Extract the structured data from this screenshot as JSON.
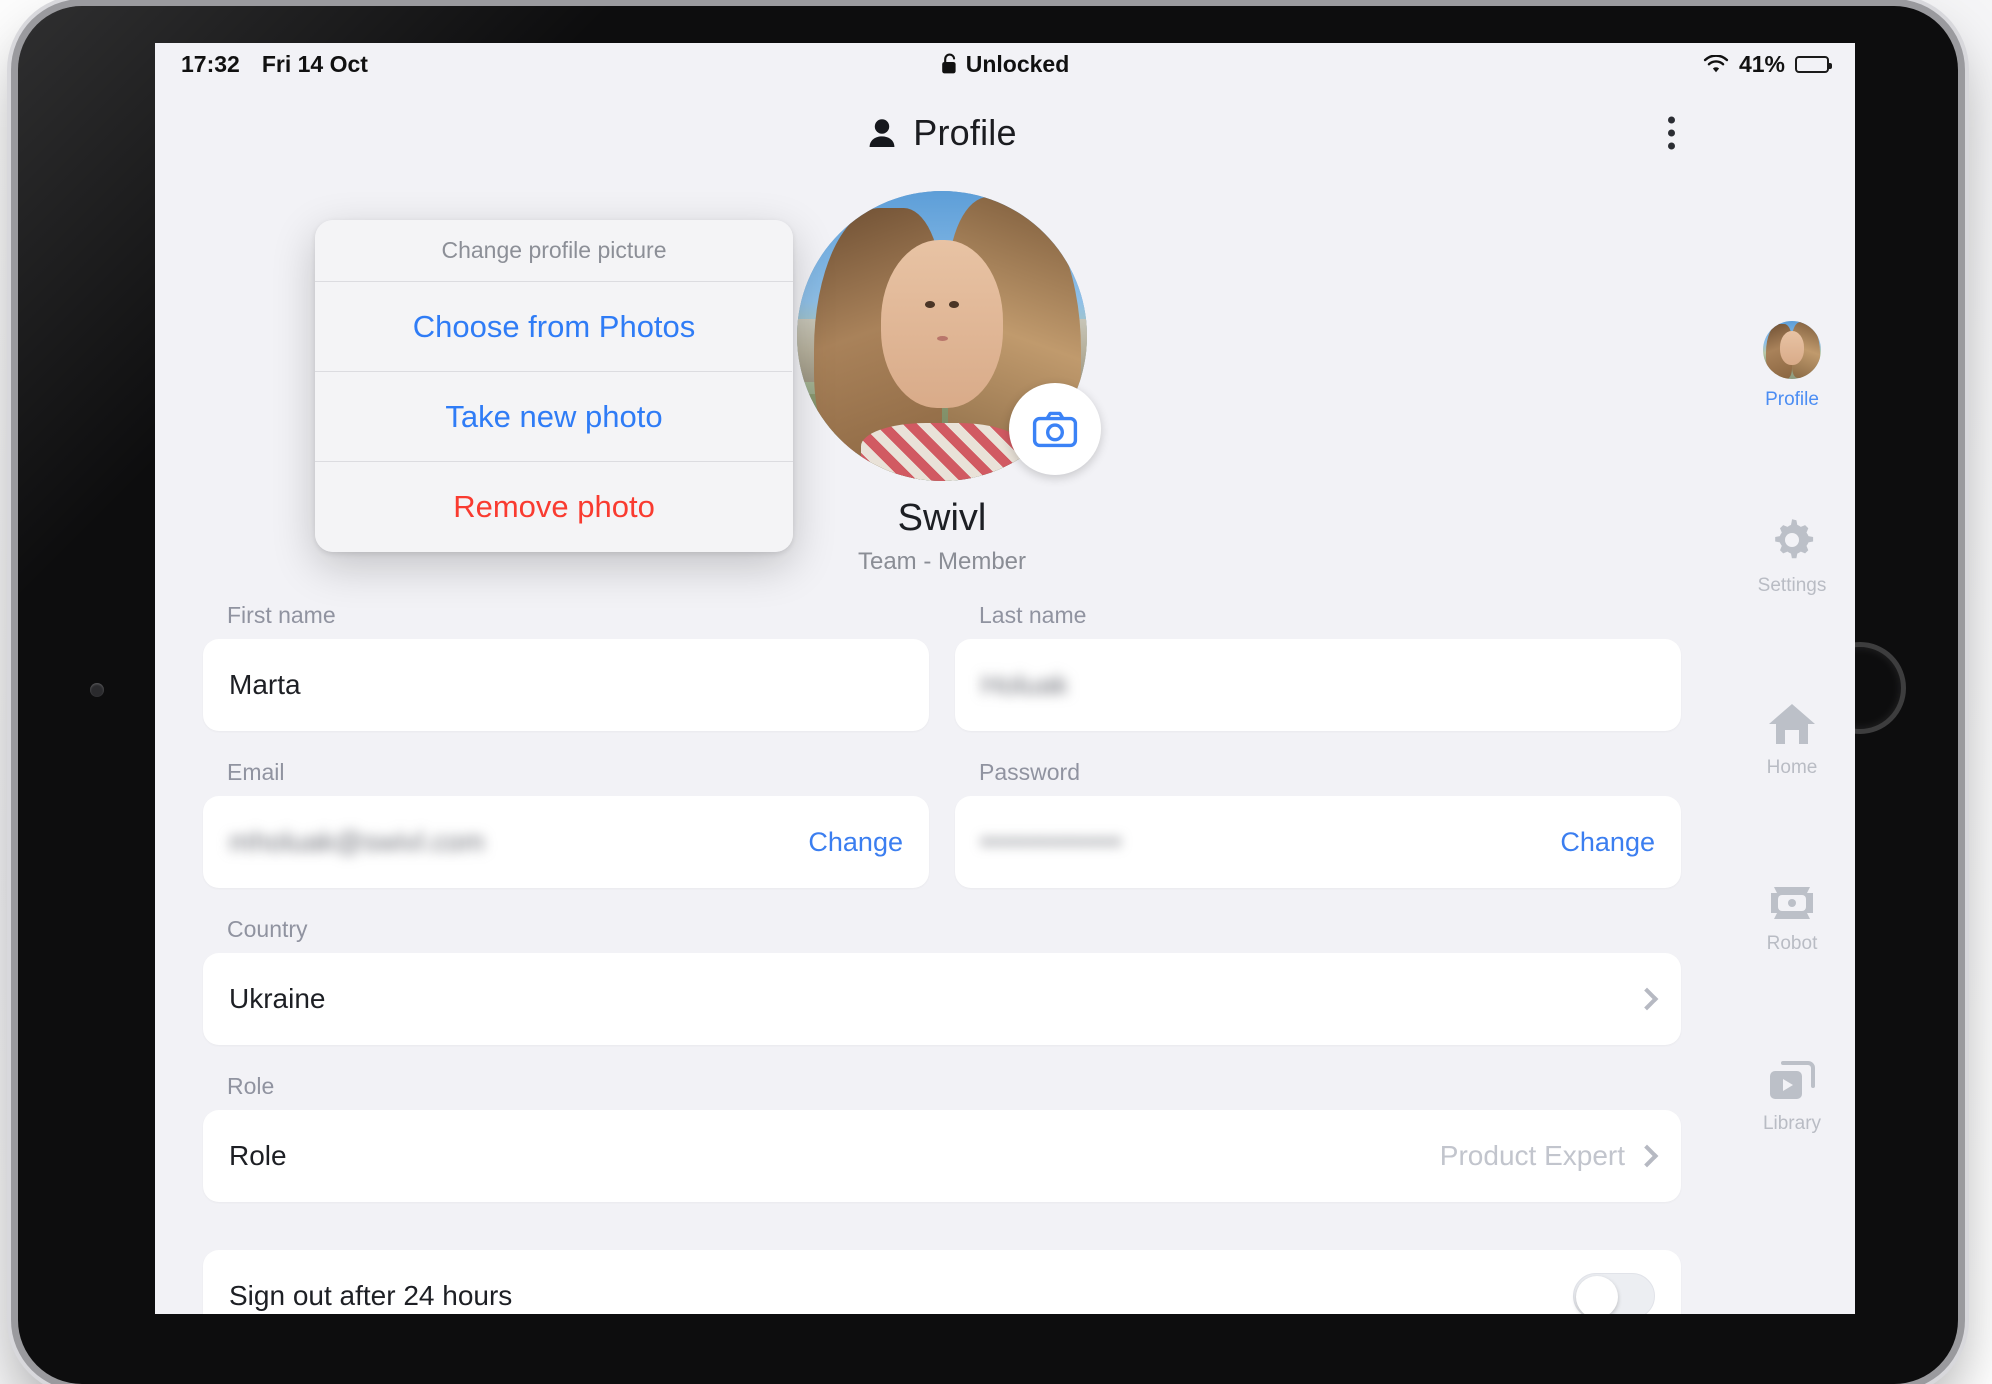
{
  "status_bar": {
    "time": "17:32",
    "date": "Fri 14 Oct",
    "center_label": "Unlocked",
    "lock_icon": "unlocked-padlock-icon",
    "wifi_icon": "wifi-icon",
    "battery_percent": "41%",
    "battery_level": 41
  },
  "header": {
    "title": "Profile",
    "title_icon": "person-icon",
    "overflow_icon": "more-vertical-icon"
  },
  "profile": {
    "name": "Swivl",
    "subtitle": "Team - Member",
    "camera_icon": "camera-icon",
    "avatar": "user-avatar"
  },
  "popover": {
    "title": "Change profile picture",
    "items": [
      {
        "label": "Choose from Photos",
        "style": "blue"
      },
      {
        "label": "Take new photo",
        "style": "blue"
      },
      {
        "label": "Remove photo",
        "style": "red"
      }
    ]
  },
  "form": {
    "first_name": {
      "label": "First name",
      "value": "Marta"
    },
    "last_name": {
      "label": "Last name",
      "value": "Holuak",
      "redacted": true
    },
    "email": {
      "label": "Email",
      "value": "mholuak@swivl.com",
      "redacted": true,
      "action": "Change"
    },
    "password": {
      "label": "Password",
      "value": "••••••••••••",
      "redacted": true,
      "action": "Change"
    },
    "country": {
      "label": "Country",
      "value": "Ukraine",
      "chevron": "chevron-right-icon"
    },
    "role": {
      "label": "Role",
      "row_label": "Role",
      "value": "Product Expert",
      "chevron": "chevron-right-icon"
    },
    "sign_out": {
      "label": "Sign out after 24 hours",
      "enabled": false
    }
  },
  "rail": {
    "items": [
      {
        "label": "Profile",
        "icon": "user-avatar-icon",
        "active": true
      },
      {
        "label": "Settings",
        "icon": "gear-icon",
        "active": false
      },
      {
        "label": "Home",
        "icon": "home-icon",
        "active": false
      },
      {
        "label": "Robot",
        "icon": "robot-icon",
        "active": false
      },
      {
        "label": "Library",
        "icon": "library-video-icon",
        "active": false
      }
    ]
  },
  "colors": {
    "accent_blue": "#2f7cf6",
    "destructive_red": "#f93b30",
    "link_blue": "#3b7ef0",
    "screen_bg": "#f2f2f6",
    "card_bg": "#ffffff",
    "muted_text": "#9093a0"
  }
}
